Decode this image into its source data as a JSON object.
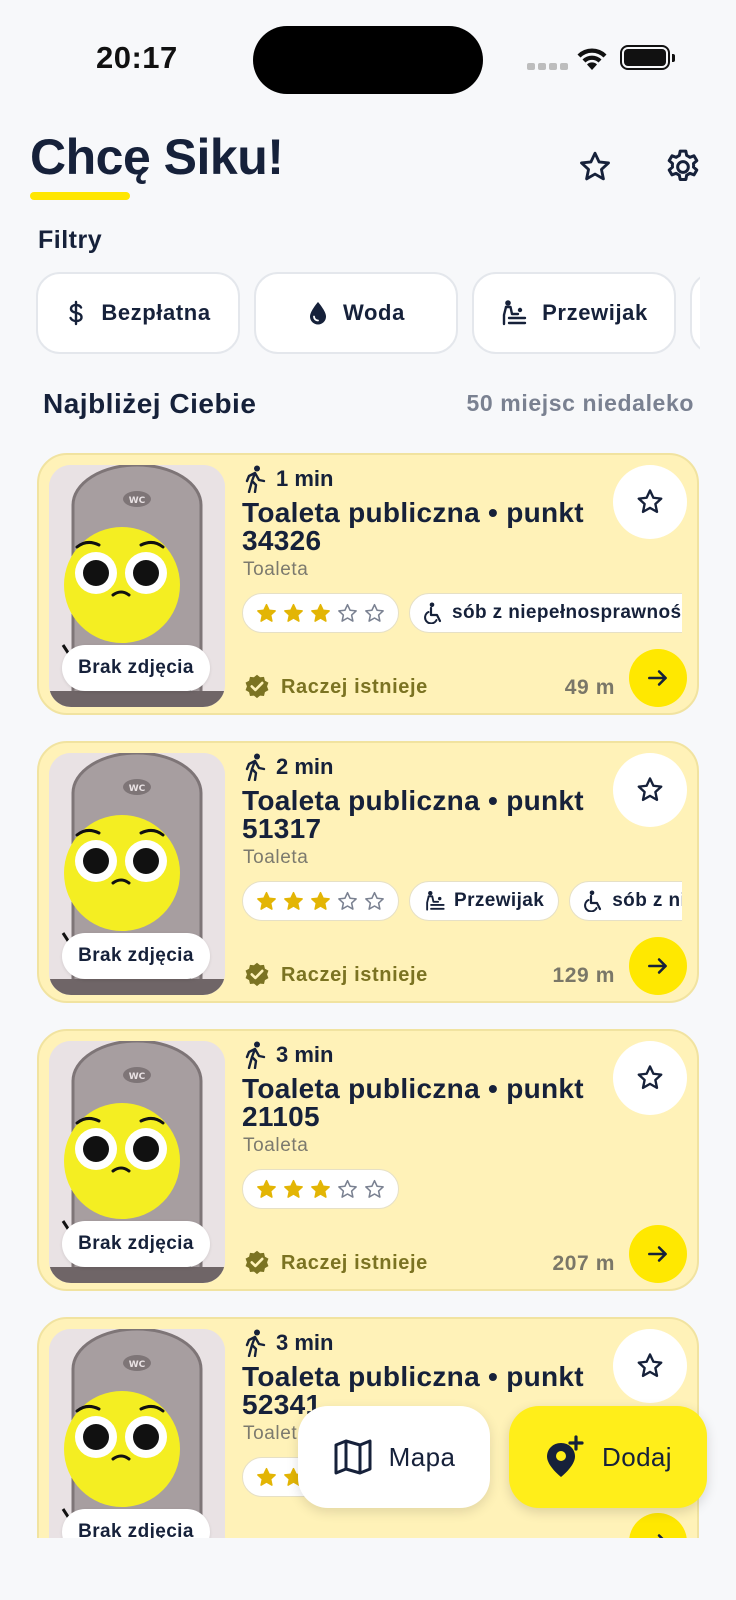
{
  "status_bar": {
    "time": "20:17"
  },
  "header": {
    "title": "Chcę Siku!",
    "favorites_icon": "star-outline-icon",
    "settings_icon": "gear-icon"
  },
  "filters": {
    "label": "Filtry",
    "chips": [
      {
        "label": "Bezpłatna",
        "icon": "dollar-icon"
      },
      {
        "label": "Woda",
        "icon": "water-drop-icon"
      },
      {
        "label": "Przewijak",
        "icon": "baby-changing-icon"
      }
    ]
  },
  "nearby": {
    "title": "Najbliżej Ciebie",
    "count_text": "50 miejsc niedaleko"
  },
  "places": [
    {
      "walk_time": "1 min",
      "title": "Toaleta publiczna • punkt 34326",
      "type": "Toaleta",
      "rating": 3,
      "rating_max": 5,
      "tags": [
        {
          "label": "sób z niepełnosprawnośc",
          "icon": "wheelchair-icon"
        }
      ],
      "no_photo": "Brak zdjęcia",
      "status": "Raczej istnieje",
      "distance": "49 m"
    },
    {
      "walk_time": "2 min",
      "title": "Toaleta publiczna • punkt 51317",
      "type": "Toaleta",
      "rating": 3,
      "rating_max": 5,
      "tags": [
        {
          "label": "Przewijak",
          "icon": "baby-changing-icon"
        },
        {
          "label": "sób z nie",
          "icon": "wheelchair-icon"
        }
      ],
      "no_photo": "Brak zdjęcia",
      "status": "Raczej istnieje",
      "distance": "129 m"
    },
    {
      "walk_time": "3 min",
      "title": "Toaleta publiczna • punkt 21105",
      "type": "Toaleta",
      "rating": 3,
      "rating_max": 5,
      "tags": [],
      "no_photo": "Brak zdjęcia",
      "status": "Raczej istnieje",
      "distance": "207 m"
    },
    {
      "walk_time": "3 min",
      "title": "Toaleta publiczna • punkt 52341",
      "type": "Toalet",
      "rating": 3,
      "rating_max": 5,
      "tags": [],
      "no_photo": "Brak zdjęcia",
      "status": "",
      "distance": ""
    }
  ],
  "actions": {
    "map_label": "Mapa",
    "add_label": "Dodaj"
  },
  "colors": {
    "accent": "#FFE800",
    "card_bg": "#FFF2B8",
    "text": "#16213A",
    "star": "#E3B505",
    "status_text": "#7B7322"
  }
}
